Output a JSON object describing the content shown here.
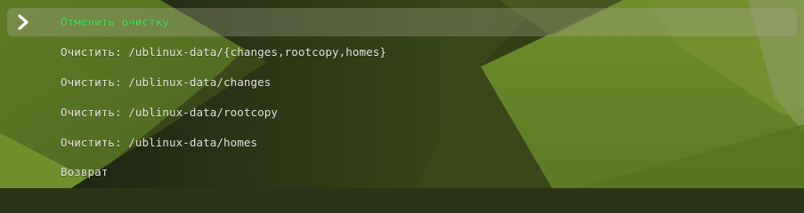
{
  "menu": {
    "items": [
      {
        "label": "Отменить очистку",
        "selected": true
      },
      {
        "label": "Очистить: /ublinux-data/{changes,rootcopy,homes}",
        "selected": false
      },
      {
        "label": "Очистить: /ublinux-data/changes",
        "selected": false
      },
      {
        "label": "Очистить: /ublinux-data/rootcopy",
        "selected": false
      },
      {
        "label": "Очистить: /ublinux-data/homes",
        "selected": false
      },
      {
        "label": "Возврат",
        "selected": false
      }
    ],
    "selection_icon": "chevron-right-icon"
  },
  "colors": {
    "selected_text": "#4fe35a",
    "text": "#e6e6dc",
    "background_green": "#6b8a2a",
    "background_dark": "#2b3416"
  }
}
